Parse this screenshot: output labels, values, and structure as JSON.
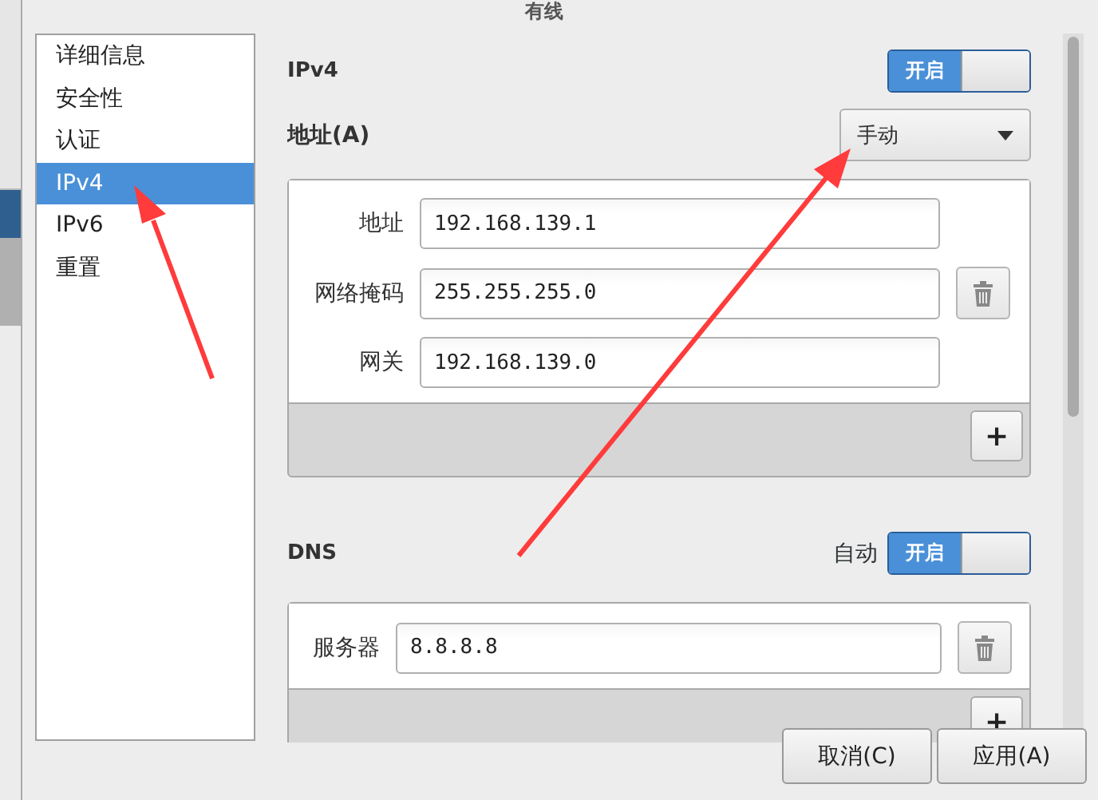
{
  "window": {
    "title": "有线"
  },
  "sidebar": {
    "items": [
      {
        "label": "详细信息",
        "selected": false
      },
      {
        "label": "安全性",
        "selected": false
      },
      {
        "label": "认证",
        "selected": false
      },
      {
        "label": "IPv4",
        "selected": true
      },
      {
        "label": "IPv6",
        "selected": false
      },
      {
        "label": "重置",
        "selected": false
      }
    ]
  },
  "ipv4": {
    "title": "IPv4",
    "switch": {
      "label": "开启",
      "on": true
    },
    "address_label": "地址(A)",
    "method": "手动",
    "fields": [
      {
        "label": "地址",
        "value": "192.168.139.1",
        "removable": false
      },
      {
        "label": "网络掩码",
        "value": "255.255.255.0",
        "removable": true
      },
      {
        "label": "网关",
        "value": "192.168.139.0",
        "removable": false
      }
    ],
    "add": "+"
  },
  "dns": {
    "title": "DNS",
    "auto_label": "自动",
    "switch": {
      "label": "开启",
      "on": true
    },
    "servers": [
      {
        "label": "服务器",
        "value": "8.8.8.8",
        "removable": true
      }
    ],
    "add": "+"
  },
  "buttons": [
    {
      "label": "取消(C)"
    },
    {
      "label": "应用(A)"
    }
  ]
}
